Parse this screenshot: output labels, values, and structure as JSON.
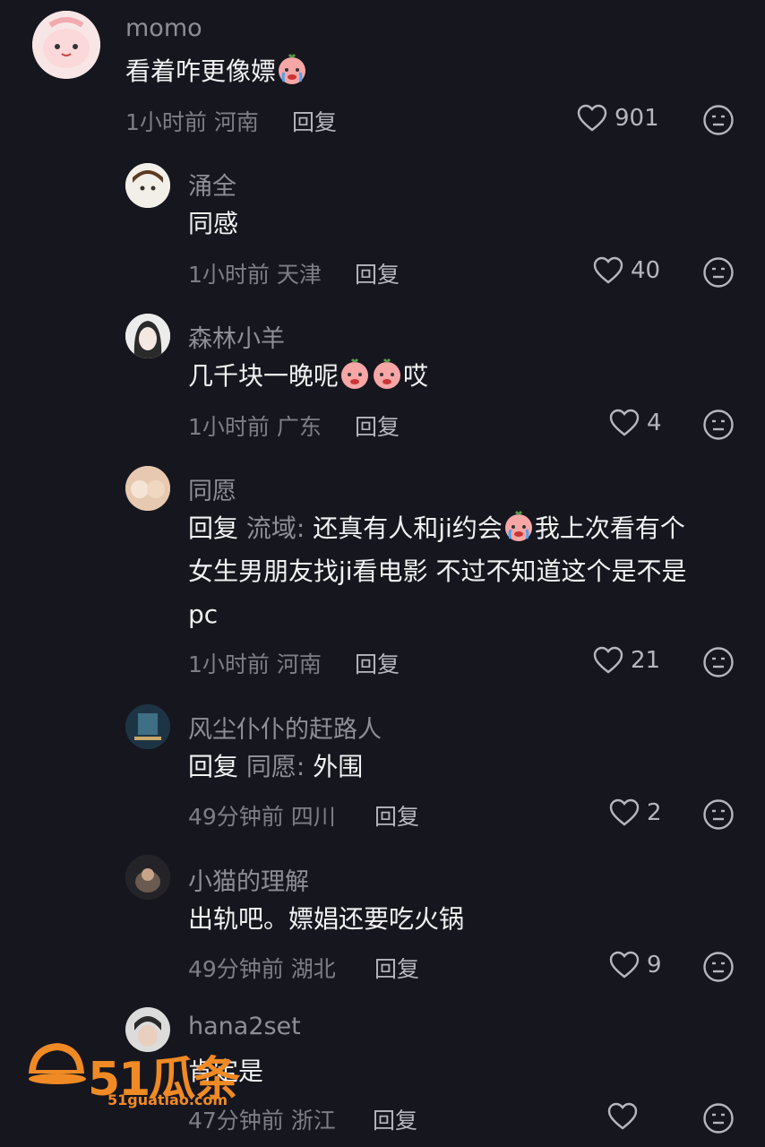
{
  "comments": [
    {
      "user": "momo",
      "text": "看着咋更像嫖",
      "time": "1小时前",
      "location": "河南",
      "reply": "回复",
      "likes": "901"
    },
    {
      "user": "涌全",
      "text": "同感",
      "time": "1小时前",
      "location": "天津",
      "reply": "回复",
      "likes": "40"
    },
    {
      "user": "森林小羊",
      "text_pre": "几千块一晚呢",
      "text_post": "哎",
      "time": "1小时前",
      "location": "广东",
      "reply": "回复",
      "likes": "4"
    },
    {
      "user": "同愿",
      "reply_label": "回复",
      "reply_target": "流域:",
      "line1_a": "还真有人和ji约会",
      "line1_b": "我上次看有个",
      "line2": "女生男朋友找ji看电影 不过不知道这个是不是",
      "line3": "pc",
      "time": "1小时前",
      "location": "河南",
      "reply": "回复",
      "likes": "21"
    },
    {
      "user": "风尘仆仆的赶路人",
      "reply_label": "回复",
      "reply_target": "同愿:",
      "text": "外围",
      "time": "49分钟前",
      "location": "四川",
      "reply": "回复",
      "likes": "2"
    },
    {
      "user": "小猫的理解",
      "text": "出轨吧。嫖娼还要吃火锅",
      "time": "49分钟前",
      "location": "湖北",
      "reply": "回复",
      "likes": "9"
    },
    {
      "user": "hana2set",
      "text": "肯定是",
      "time": "47分钟前",
      "location": "浙江",
      "reply": "回复",
      "likes": ""
    }
  ],
  "icons": {
    "like": "heart-icon",
    "dislike": "sad-face-icon",
    "emoji": "crying-peach-emoji"
  },
  "watermark": {
    "text": "51瓜条",
    "url": "51guatiao.com"
  },
  "colors": {
    "background": "#16161e",
    "accent": "#f08a24"
  }
}
